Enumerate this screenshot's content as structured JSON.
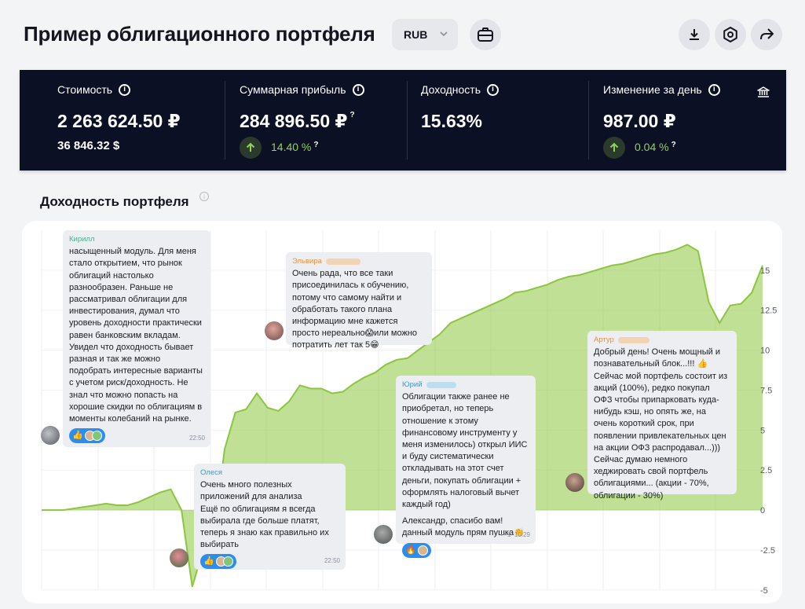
{
  "header": {
    "title": "Пример облигационного портфеля",
    "currency": "RUB",
    "icons": [
      "briefcase-icon",
      "download-icon",
      "settings-icon",
      "share-icon"
    ]
  },
  "stats": [
    {
      "label": "Стоимость",
      "value": "2 263 624.50 ₽",
      "sub": "36 846.32 $"
    },
    {
      "label": "Суммарная прибыль",
      "value": "284 896.50 ₽",
      "change": "14.40 %"
    },
    {
      "label": "Доходность",
      "value": "15.63%"
    },
    {
      "label": "Изменение за день",
      "value": "987.00 ₽",
      "change": "0.04 %"
    }
  ],
  "section_title": "Доходность портфеля",
  "chart_data": {
    "type": "area",
    "yticks": [
      "15",
      "12.5",
      "10",
      "7.5",
      "5",
      "2.5",
      "0",
      "-2.5",
      "-5"
    ],
    "ylim": [
      -5,
      15
    ],
    "color": "#8cc63f",
    "series": [
      {
        "values": [
          0,
          0,
          0,
          0.1,
          0.2,
          0.3,
          0.4,
          0.3,
          0.3,
          0.5,
          0.8,
          1.1,
          1.3,
          0,
          -4.8,
          -2.5,
          -1.8,
          3.8,
          6.1,
          6.3,
          7.3,
          6.4,
          6.2,
          6.8,
          7.8,
          7.6,
          7.6,
          7.3,
          7.4,
          7.9,
          8.3,
          8.6,
          9.1,
          9.4,
          9.5,
          10.0,
          10.5,
          11.0,
          11.7,
          12.0,
          12.3,
          12.6,
          12.9,
          13.2,
          13.6,
          13.7,
          13.9,
          14.1,
          14.4,
          14.6,
          14.7,
          14.9,
          15.1,
          15.3,
          15.4,
          15.6,
          15.8,
          16.0,
          16.1,
          16.3,
          16.6,
          16.2,
          13.0,
          11.7,
          12.8,
          12.9,
          13.6,
          15.3
        ]
      }
    ]
  },
  "messages": [
    {
      "name": "Кирилл",
      "text": "насыщенный модуль. Для меня стало открытием, что рынок облигаций настолько разнообразен. Раньше не рассматривал облигации для инвестирования, думал что уровень доходности практически равен банковским вкладам. Увидел что доходность бывает разная и так же можно подобрать интересные варианты с учетом риск/доходность. Не знал что можно попасть на хорошие скидки по облигациям в моменты колебаний на рынке.",
      "time": "22:50"
    },
    {
      "name": "Эльвира",
      "text": "Очень рада, что все таки присоединилась к обучению, потому что самому найти и обработать такого плана информацию мне кажется просто нереально😱или можно потратить лет так 5😁"
    },
    {
      "name": "Олеся",
      "text": "Очень много полезных приложений для анализа\nЕщё по облигациям я всегда выбирала где больше платят, теперь я знаю как правильно их выбирать",
      "time": "22:50"
    },
    {
      "name": "Юрий",
      "text": "Облигации также ранее не приобретал, но теперь отношение к этому финансовому инструменту у меня изменилось) открыл ИИС и буду систематически откладывать на этот счет деньги, покупать облигации + оформлять налоговый вычет каждый год)",
      "text2": "Александр, спасибо вам! данный модуль прям пушка👏",
      "time": "10:29",
      "replies": "1"
    },
    {
      "name": "Артур",
      "text": "Добрый день! Очень мощный и познавательный блок...!!! 👍 Сейчас мой портфель состоит из акций (100%), редко покупал ОФЗ чтобы припарковать куда-нибудь кэш, но опять же, на очень короткий срок, при появлении привлекательных цен на акции ОФЗ распродавал...))) Сейчас думаю немного хеджировать свой портфель облигациями... (акции - 70%, облигации - 30%)"
    }
  ]
}
